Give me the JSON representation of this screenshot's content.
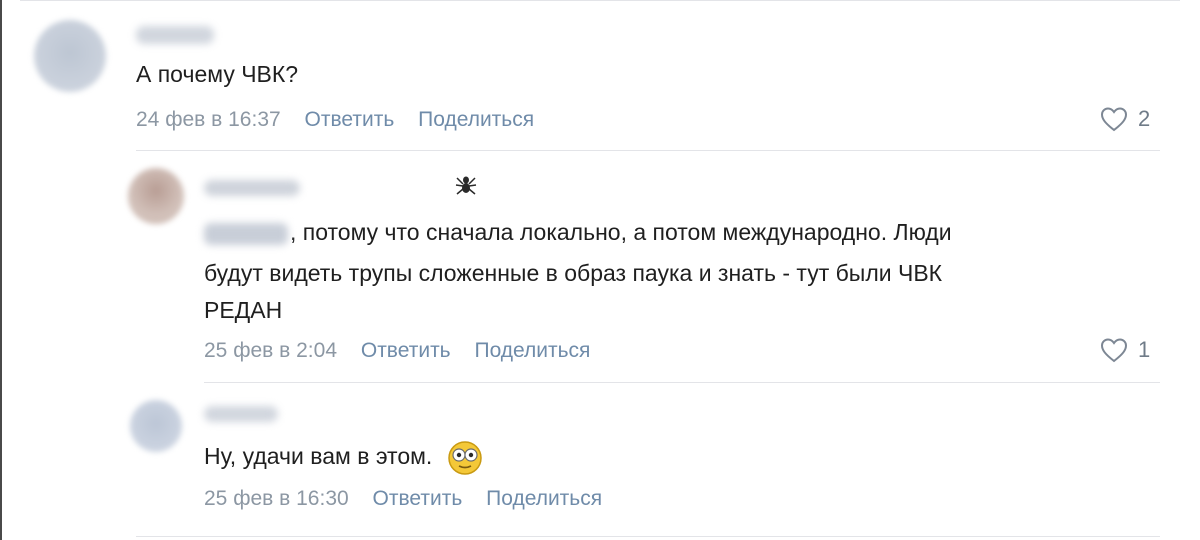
{
  "comments": [
    {
      "text": "А почему ЧВК?",
      "date": "24 фев в 16:37",
      "reply_label": "Ответить",
      "share_label": "Поделиться",
      "likes": "2"
    },
    {
      "text_line1": ", потому что сначала локально, а потом международно. Люди",
      "text_line2": "будут видеть трупы сложенные в образ паука и знать - тут были ЧВК",
      "text_line3": "РЕДАН",
      "date": "25 фев в 2:04",
      "reply_label": "Ответить",
      "share_label": "Поделиться",
      "likes": "1",
      "name_badge_icon": "spider-icon"
    },
    {
      "text": "Ну, удачи вам в этом.",
      "emoji_icon": "dizzy-face-emoji-icon",
      "date": "25 фев в 16:30",
      "reply_label": "Ответить",
      "share_label": "Поделиться"
    }
  ],
  "colors": {
    "text": "#1f1f1f",
    "date": "#8c97a3",
    "action": "#6f8ba9",
    "divider": "#e3e4e8"
  }
}
